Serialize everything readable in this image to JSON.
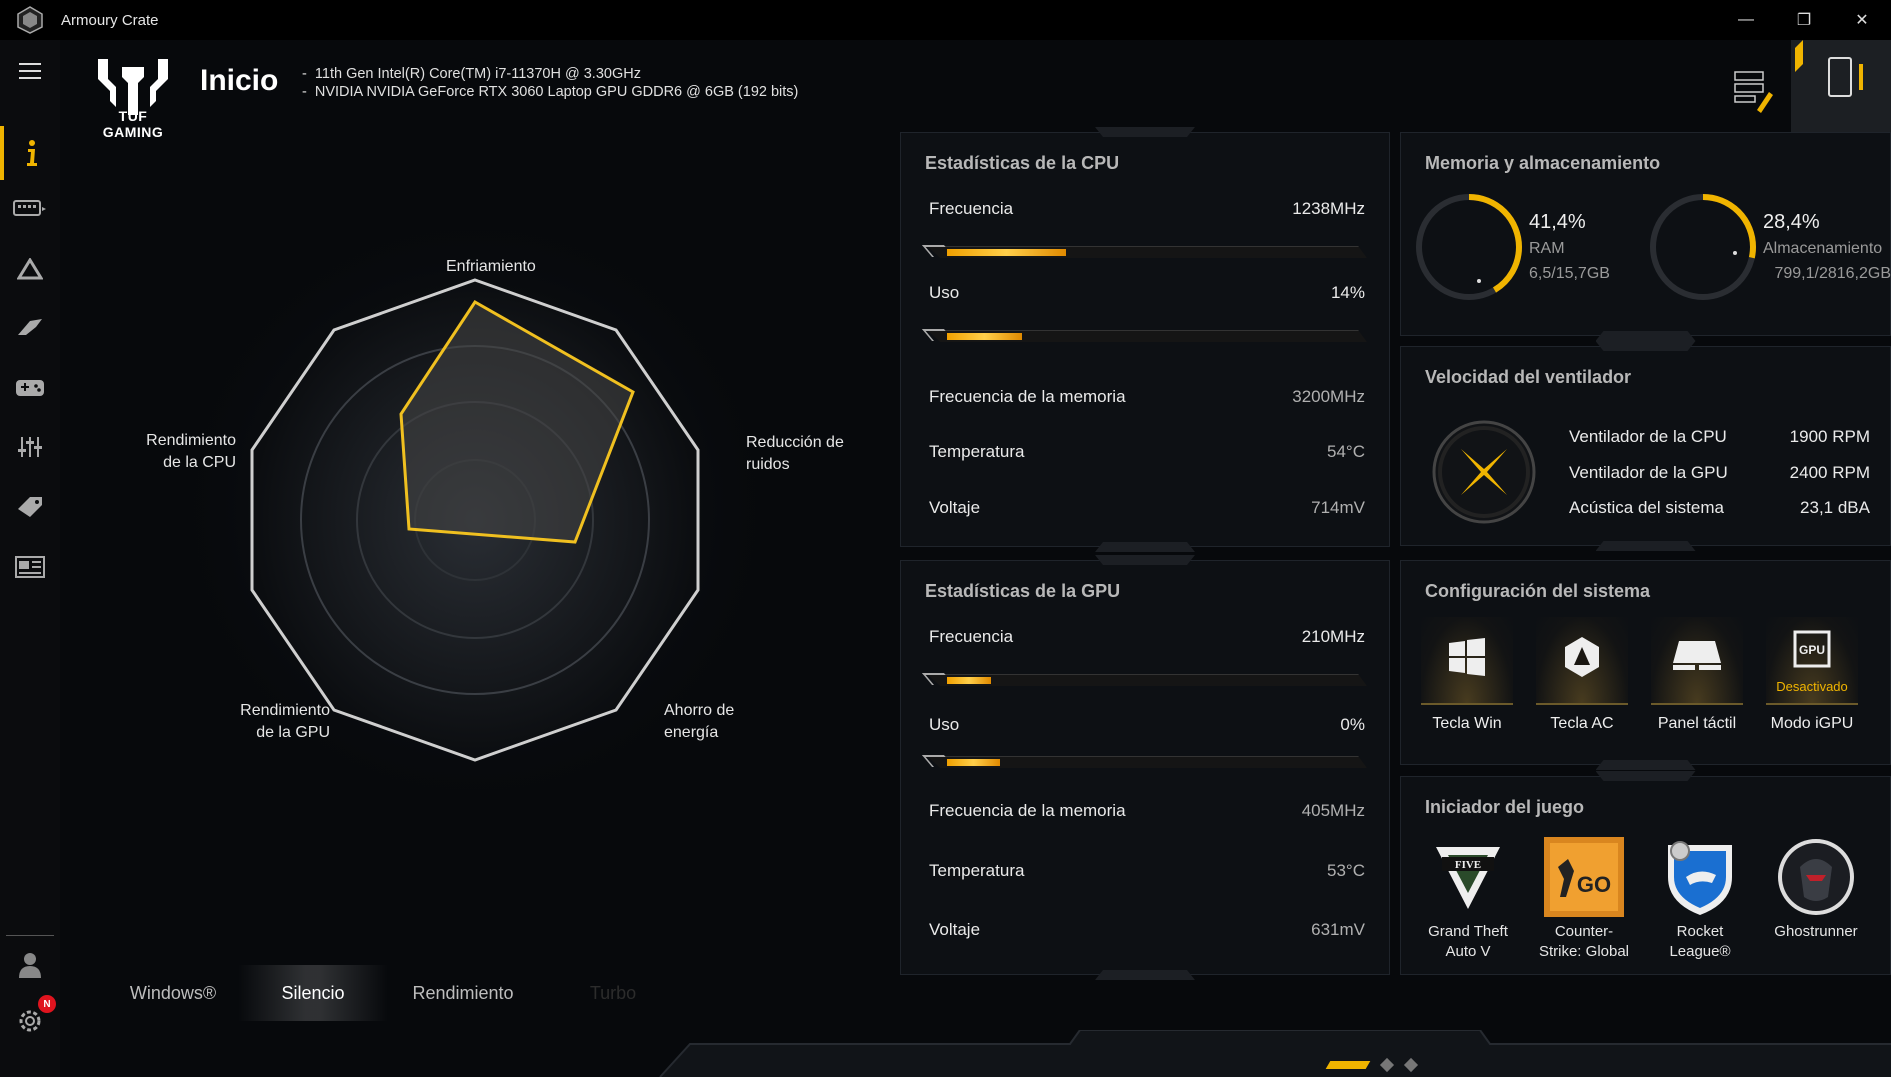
{
  "window": {
    "title": "Armoury Crate",
    "minimize": "—",
    "restore": "❐",
    "close": "✕"
  },
  "brand": {
    "text": "TUF GAMING"
  },
  "header": {
    "title": "Inicio",
    "specs": [
      "11th Gen Intel(R) Core(TM) i7-11370H @ 3.30GHz",
      "NVIDIA NVIDIA GeForce RTX 3060 Laptop GPU GDDR6 @ 6GB (192 bits)"
    ]
  },
  "sidebar": {
    "items": [
      {
        "icon": "menu-icon"
      },
      {
        "icon": "info-icon",
        "active": true
      },
      {
        "icon": "keyboard-icon"
      },
      {
        "icon": "aura-icon"
      },
      {
        "icon": "armoury-icon"
      },
      {
        "icon": "gamepad-icon"
      },
      {
        "icon": "sliders-icon"
      },
      {
        "icon": "tag-icon"
      },
      {
        "icon": "news-icon"
      },
      {
        "icon": "user-icon"
      },
      {
        "icon": "gear-icon"
      }
    ],
    "badge": "N"
  },
  "radar": {
    "labels": {
      "top": "Enfriamiento",
      "right1": "Reducción de",
      "right2": "ruidos",
      "left1": "Rendimiento",
      "left2": "de la CPU",
      "botleft1": "Rendimiento",
      "botleft2": "de la GPU",
      "botright1": "Ahorro de",
      "botright2": "energía"
    }
  },
  "modes": {
    "windows": "Windows®",
    "silent": "Silencio",
    "performance": "Rendimiento",
    "turbo": "Turbo",
    "active": "Silencio"
  },
  "cpu": {
    "title": "Estadísticas de la CPU",
    "freq_label": "Frecuencia",
    "freq_value": "1238MHz",
    "freq_fraction": 0.27,
    "usage_label": "Uso",
    "usage_value": "14%",
    "usage_fraction": 0.17,
    "mem_label": "Frecuencia de la memoria",
    "mem_value": "3200MHz",
    "temp_label": "Temperatura",
    "temp_value": "54°C",
    "volt_label": "Voltaje",
    "volt_value": "714mV"
  },
  "gpu": {
    "title": "Estadísticas de la GPU",
    "freq_label": "Frecuencia",
    "freq_value": "210MHz",
    "freq_fraction": 0.1,
    "usage_label": "Uso",
    "usage_value": "0%",
    "usage_fraction": 0.12,
    "mem_label": "Frecuencia de la memoria",
    "mem_value": "405MHz",
    "temp_label": "Temperatura",
    "temp_value": "53°C",
    "volt_label": "Voltaje",
    "volt_value": "631mV"
  },
  "memory": {
    "title": "Memoria y almacenamiento",
    "ram_pct": "41,4%",
    "ram_label": "RAM",
    "ram_detail": "6,5/15,7GB",
    "ram_fraction": 0.414,
    "sto_pct": "28,4%",
    "sto_label": "Almacenamiento",
    "sto_detail": "799,1/2816,2GB",
    "sto_fraction": 0.284,
    "accent": "#f0b400"
  },
  "fans": {
    "title": "Velocidad del ventilador",
    "rows": [
      {
        "label": "Ventilador de la CPU",
        "value": "1900 RPM"
      },
      {
        "label": "Ventilador de la GPU",
        "value": "2400 RPM"
      },
      {
        "label": "Acústica del sistema",
        "value": "23,1 dBA"
      }
    ]
  },
  "sysconfig": {
    "title": "Configuración del sistema",
    "items": [
      {
        "label": "Tecla Win",
        "icon": "windows-icon"
      },
      {
        "label": "Tecla AC",
        "icon": "armoury-crate-icon"
      },
      {
        "label": "Panel táctil",
        "icon": "touchpad-icon"
      },
      {
        "label": "Modo iGPU",
        "icon": "gpu-icon",
        "status": "Desactivado"
      }
    ]
  },
  "games": {
    "title": "Iniciador del juego",
    "items": [
      {
        "label1": "Grand Theft",
        "label2": "Auto V"
      },
      {
        "label1": "Counter-",
        "label2": "Strike: Global"
      },
      {
        "label1": "Rocket",
        "label2": "League®"
      },
      {
        "label1": "Ghostrunner",
        "label2": ""
      }
    ]
  }
}
